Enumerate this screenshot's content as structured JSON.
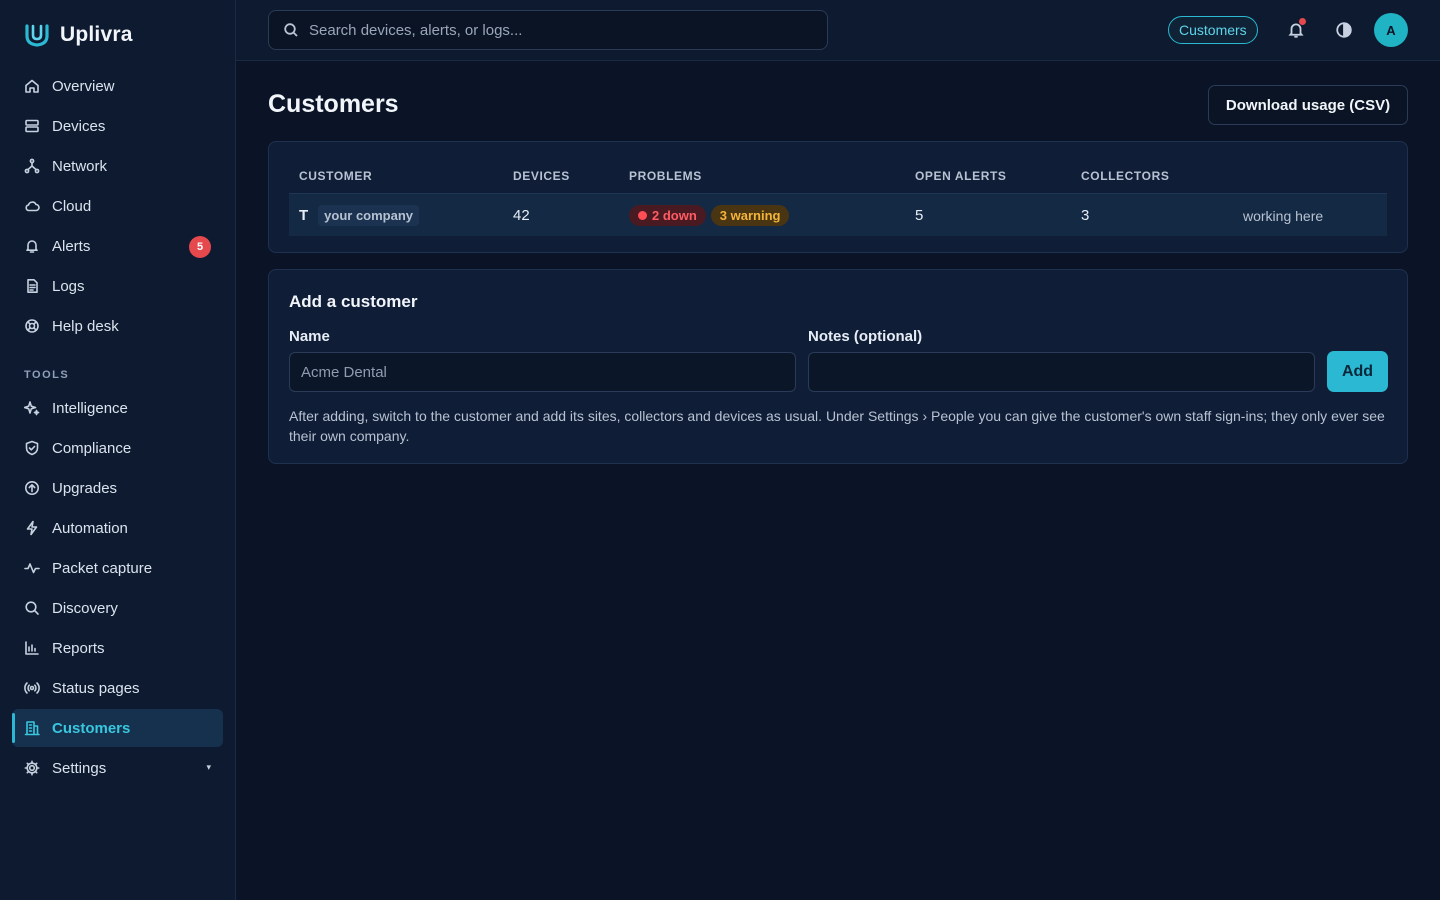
{
  "app": {
    "name": "Uplivra"
  },
  "colors": {
    "accent": "#2bb8d2",
    "danger": "#e5484d",
    "warning": "#f3b43b",
    "background": "#0b1426"
  },
  "sidebar": {
    "items": [
      {
        "label": "Overview",
        "icon": "home-icon"
      },
      {
        "label": "Devices",
        "icon": "server-icon"
      },
      {
        "label": "Network",
        "icon": "network-icon"
      },
      {
        "label": "Cloud",
        "icon": "cloud-icon"
      },
      {
        "label": "Alerts",
        "icon": "bell-icon",
        "badge": "5"
      },
      {
        "label": "Logs",
        "icon": "file-icon"
      },
      {
        "label": "Help desk",
        "icon": "lifebuoy-icon"
      }
    ],
    "tools_label": "TOOLS",
    "tools": [
      {
        "label": "Intelligence",
        "icon": "sparkles-icon"
      },
      {
        "label": "Compliance",
        "icon": "shield-icon"
      },
      {
        "label": "Upgrades",
        "icon": "arrow-up-circle-icon"
      },
      {
        "label": "Automation",
        "icon": "bolt-icon"
      },
      {
        "label": "Packet capture",
        "icon": "activity-icon"
      },
      {
        "label": "Discovery",
        "icon": "search-icon"
      },
      {
        "label": "Reports",
        "icon": "bar-chart-icon"
      },
      {
        "label": "Status pages",
        "icon": "broadcast-icon"
      },
      {
        "label": "Customers",
        "icon": "building-icon",
        "active": true
      },
      {
        "label": "Settings",
        "icon": "gear-icon",
        "caret": "▾"
      }
    ]
  },
  "topbar": {
    "search_placeholder": "Search devices, alerts, or logs...",
    "context_chip": "Customers",
    "avatar_initial": "A"
  },
  "page": {
    "title": "Customers",
    "download_button": "Download usage (CSV)"
  },
  "table": {
    "headers": {
      "customer": "CUSTOMER",
      "devices": "DEVICES",
      "problems": "PROBLEMS",
      "open_alerts": "OPEN ALERTS",
      "collectors": "COLLECTORS"
    },
    "rows": [
      {
        "initial": "T",
        "tag": "your company",
        "devices": "42",
        "down": "2 down",
        "warning": "3 warning",
        "open_alerts": "5",
        "collectors": "3",
        "status": "working here"
      }
    ]
  },
  "add_form": {
    "title": "Add a customer",
    "name_label": "Name",
    "name_placeholder": "Acme Dental",
    "notes_label": "Notes (optional)",
    "notes_placeholder": "",
    "submit": "Add",
    "help": "After adding, switch to the customer and add its sites, collectors and devices as usual. Under Settings › People you can give the customer's own staff sign-ins; they only ever see their own company."
  }
}
